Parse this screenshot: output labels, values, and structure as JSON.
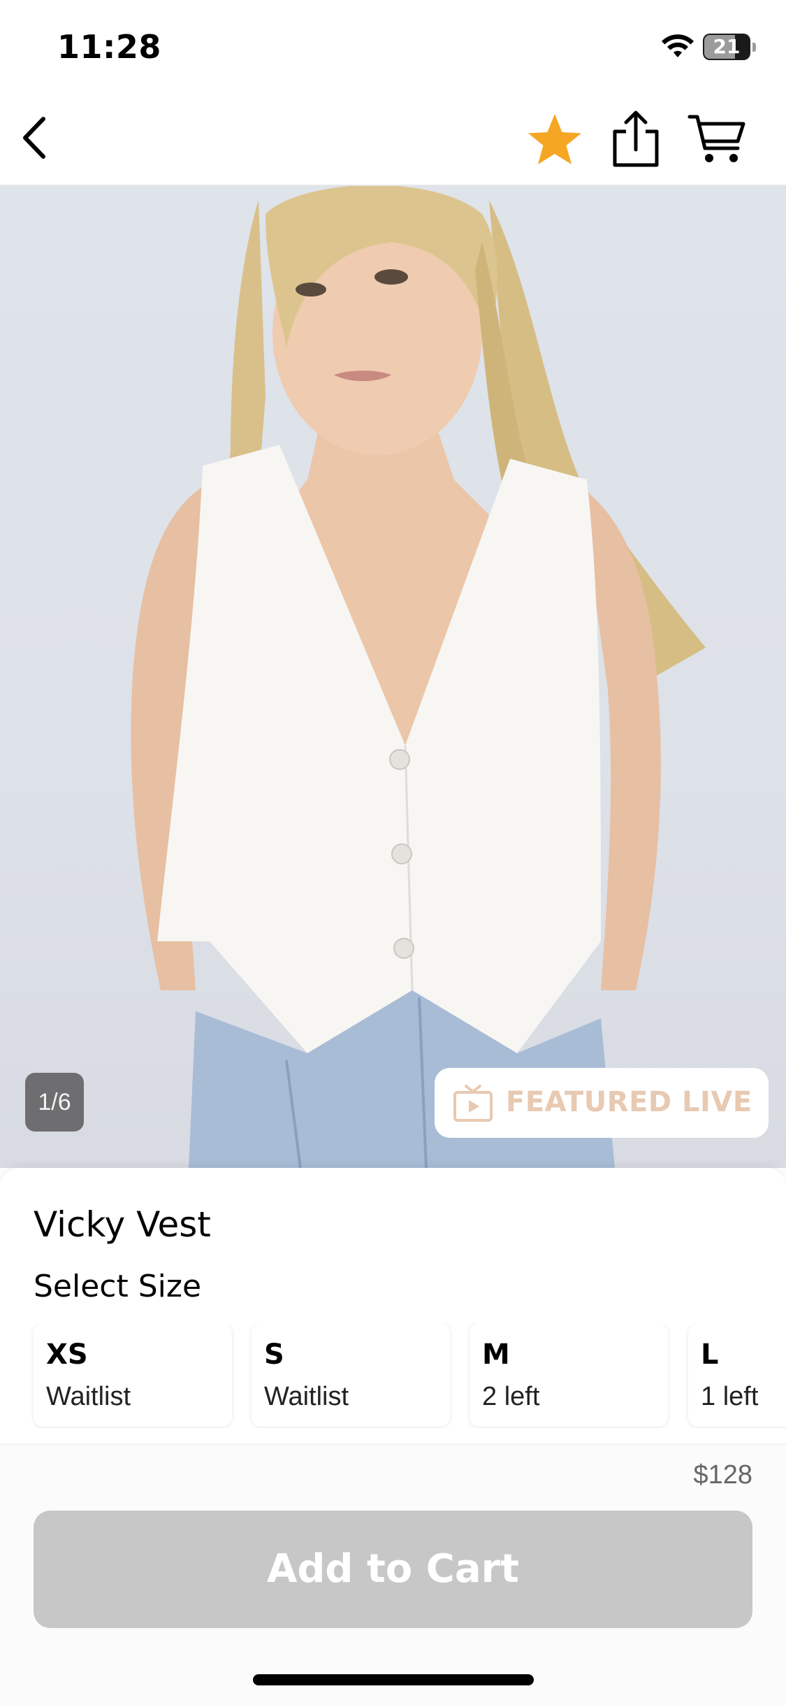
{
  "status_bar": {
    "time": "11:28",
    "battery_level": "21",
    "icons": [
      "wifi-icon",
      "battery-icon"
    ]
  },
  "nav": {
    "icons": [
      "back-chevron-icon",
      "star-icon",
      "share-icon",
      "cart-icon"
    ],
    "star_color": "#f5a623"
  },
  "gallery": {
    "page_indicator": "1/6",
    "featured_badge": "FEATURED LIVE",
    "featured_color": "#e8c9b1",
    "badge_icon": "tv-play-icon"
  },
  "product": {
    "name": "Vicky Vest",
    "select_size_label": "Select Size",
    "sizes": [
      {
        "code": "XS",
        "stock": "Waitlist"
      },
      {
        "code": "S",
        "stock": "Waitlist"
      },
      {
        "code": "M",
        "stock": "2 left"
      },
      {
        "code": "L",
        "stock": "1 left"
      }
    ],
    "price": "$128"
  },
  "cart": {
    "button_label": "Add to Cart",
    "button_color": "#c7c7c7"
  }
}
